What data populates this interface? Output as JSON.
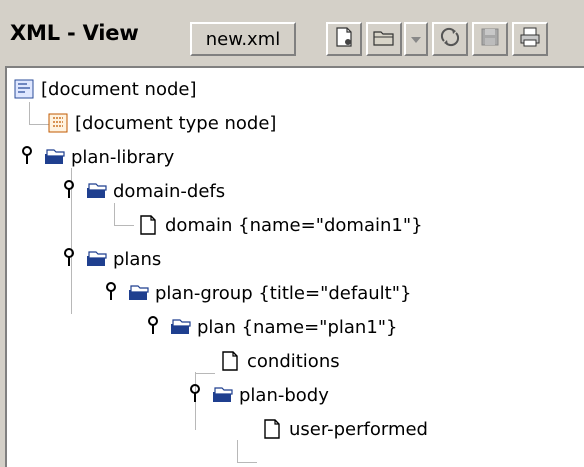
{
  "toolbar": {
    "title": "XML - View",
    "filename": "new.xml",
    "buttons": [
      {
        "name": "new-document-icon"
      },
      {
        "name": "open-folder-icon"
      },
      {
        "name": "dropdown-arrow-icon"
      },
      {
        "name": "refresh-icon"
      },
      {
        "name": "save-icon"
      },
      {
        "name": "print-icon"
      }
    ]
  },
  "tree": {
    "nodes": [
      {
        "label": "[document node]",
        "icon": "document-node-icon",
        "depth": 0,
        "expandable": false
      },
      {
        "label": "[document type node]",
        "icon": "doctype-node-icon",
        "depth": 1,
        "expandable": false
      },
      {
        "label": "plan-library",
        "icon": "open-folder-icon",
        "depth": 0,
        "expandable": true
      },
      {
        "label": "domain-defs",
        "icon": "open-folder-icon",
        "depth": 1,
        "expandable": true
      },
      {
        "label": "domain {name=\"domain1\"}",
        "icon": "leaf-document-icon",
        "depth": 2,
        "expandable": false
      },
      {
        "label": "plans",
        "icon": "open-folder-icon",
        "depth": 1,
        "expandable": true
      },
      {
        "label": "plan-group {title=\"default\"}",
        "icon": "open-folder-icon",
        "depth": 2,
        "expandable": true
      },
      {
        "label": "plan {name=\"plan1\"}",
        "icon": "open-folder-icon",
        "depth": 3,
        "expandable": true
      },
      {
        "label": "conditions",
        "icon": "leaf-document-icon",
        "depth": 4,
        "expandable": false
      },
      {
        "label": "plan-body",
        "icon": "open-folder-icon",
        "depth": 4,
        "expandable": true
      },
      {
        "label": "user-performed",
        "icon": "leaf-document-icon",
        "depth": 5,
        "expandable": false
      }
    ]
  },
  "colors": {
    "window_bg": "#d4d0c8",
    "tree_bg": "#ffffff",
    "folder_blue": "#1f3f8f",
    "guide_line": "#b8b8b8"
  }
}
